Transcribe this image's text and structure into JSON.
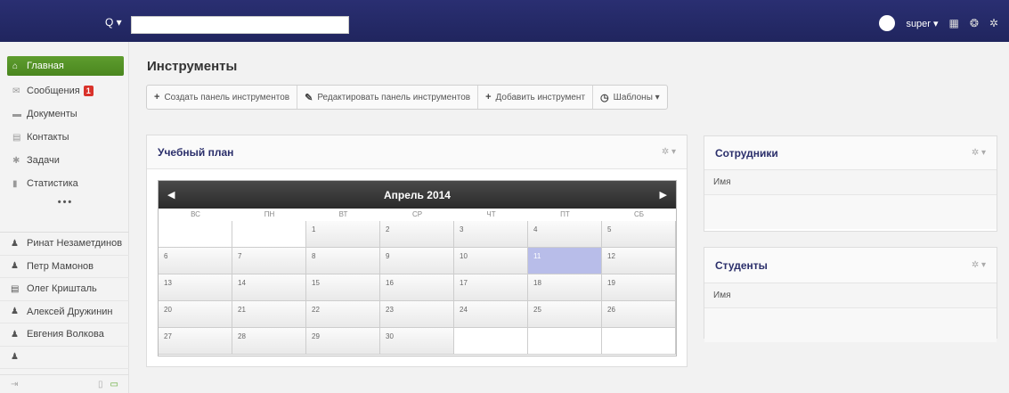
{
  "topbar": {
    "search_trigger": "Q ▾",
    "search_placeholder": "",
    "user_name": "super ▾"
  },
  "sidebar": {
    "items": [
      {
        "label": "Главная",
        "icon": "home-icon",
        "glyph": "⌂"
      },
      {
        "label": "Сообщения",
        "icon": "envelope-icon",
        "glyph": "✉",
        "badge": "1"
      },
      {
        "label": "Документы",
        "icon": "folder-icon",
        "glyph": "▬"
      },
      {
        "label": "Контакты",
        "icon": "contacts-card-icon",
        "glyph": "▤"
      },
      {
        "label": "Задачи",
        "icon": "pin-icon",
        "glyph": "✱"
      },
      {
        "label": "Статистика",
        "icon": "bar-chart-icon",
        "glyph": "▮"
      }
    ],
    "more": "•••",
    "contacts": [
      {
        "name": "Ринат Незаметдинов",
        "icon": "person-icon"
      },
      {
        "name": "Петр Мамонов",
        "icon": "person-icon"
      },
      {
        "name": "Олег Кришталь",
        "icon": "contact-card-icon"
      },
      {
        "name": "Алексей Дружинин",
        "icon": "person-icon"
      },
      {
        "name": "Евгения Волкова",
        "icon": "person-icon"
      },
      {
        "name": "",
        "icon": "person-icon"
      }
    ]
  },
  "main": {
    "title": "Инструменты",
    "toolbar": [
      {
        "label": "Создать панель инструментов",
        "glyph": "+"
      },
      {
        "label": "Редактировать панель инструментов",
        "glyph": "✎"
      },
      {
        "label": "Добавить инструмент",
        "glyph": "+"
      },
      {
        "label": "Шаблоны ▾",
        "glyph": "◷"
      }
    ]
  },
  "calendar_panel": {
    "title": "Учебный план",
    "month": "Апрель 2014",
    "prev": "◀",
    "next": "▶",
    "weekdays": [
      "ВС",
      "ПН",
      "ВТ",
      "СР",
      "ЧТ",
      "ПТ",
      "СБ"
    ],
    "weeks": [
      [
        "",
        "",
        "1",
        "2",
        "3",
        "4",
        "5"
      ],
      [
        "6",
        "7",
        "8",
        "9",
        "10",
        "11",
        "12"
      ],
      [
        "13",
        "14",
        "15",
        "16",
        "17",
        "18",
        "19"
      ],
      [
        "20",
        "21",
        "22",
        "23",
        "24",
        "25",
        "26"
      ],
      [
        "27",
        "28",
        "29",
        "30",
        "",
        "",
        ""
      ]
    ],
    "highlighted_day": "11"
  },
  "staff_panel": {
    "title": "Сотрудники",
    "column": "Имя"
  },
  "students_panel": {
    "title": "Студенты",
    "column": "Имя"
  },
  "colors": {
    "topbar": "#22276a",
    "active_menu": "#5a972a",
    "badge": "#d9322a",
    "today": "#b8bde9"
  }
}
